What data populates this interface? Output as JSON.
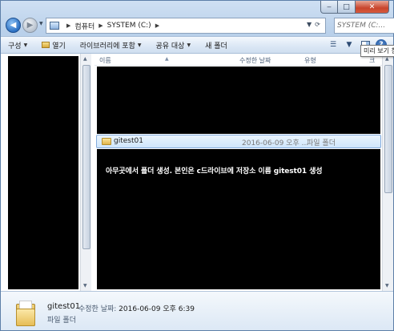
{
  "window": {
    "controls": {
      "minimize": "‒",
      "maximize": "□",
      "close": "✕"
    }
  },
  "address": {
    "crumbs": [
      "컴퓨터",
      "SYSTEM (C:)"
    ],
    "search_placeholder": "SYSTEM (C:..."
  },
  "toolbar": {
    "organize": "구성",
    "open": "열기",
    "include_library": "라이브러리에 포함",
    "share": "공유 대상",
    "new_folder": "새 폴더",
    "tooltip": "미리 보기 창"
  },
  "columns": {
    "name": "이름",
    "date": "수정한 날짜",
    "type": "유형",
    "size": "크"
  },
  "files": [
    {
      "name": "gitest01",
      "date": "2016-06-09 오후 ...",
      "type": "파일 폴더"
    }
  ],
  "caption": "아무곳에서 폴더 생성. 본인은 c드라이브에 저장소 이름 gitest01 생성",
  "details": {
    "name": "gitest01",
    "date_label": "수정한 날짜:",
    "date_value": "2016-06-09 오후 6:39",
    "type": "파일 폴더"
  }
}
